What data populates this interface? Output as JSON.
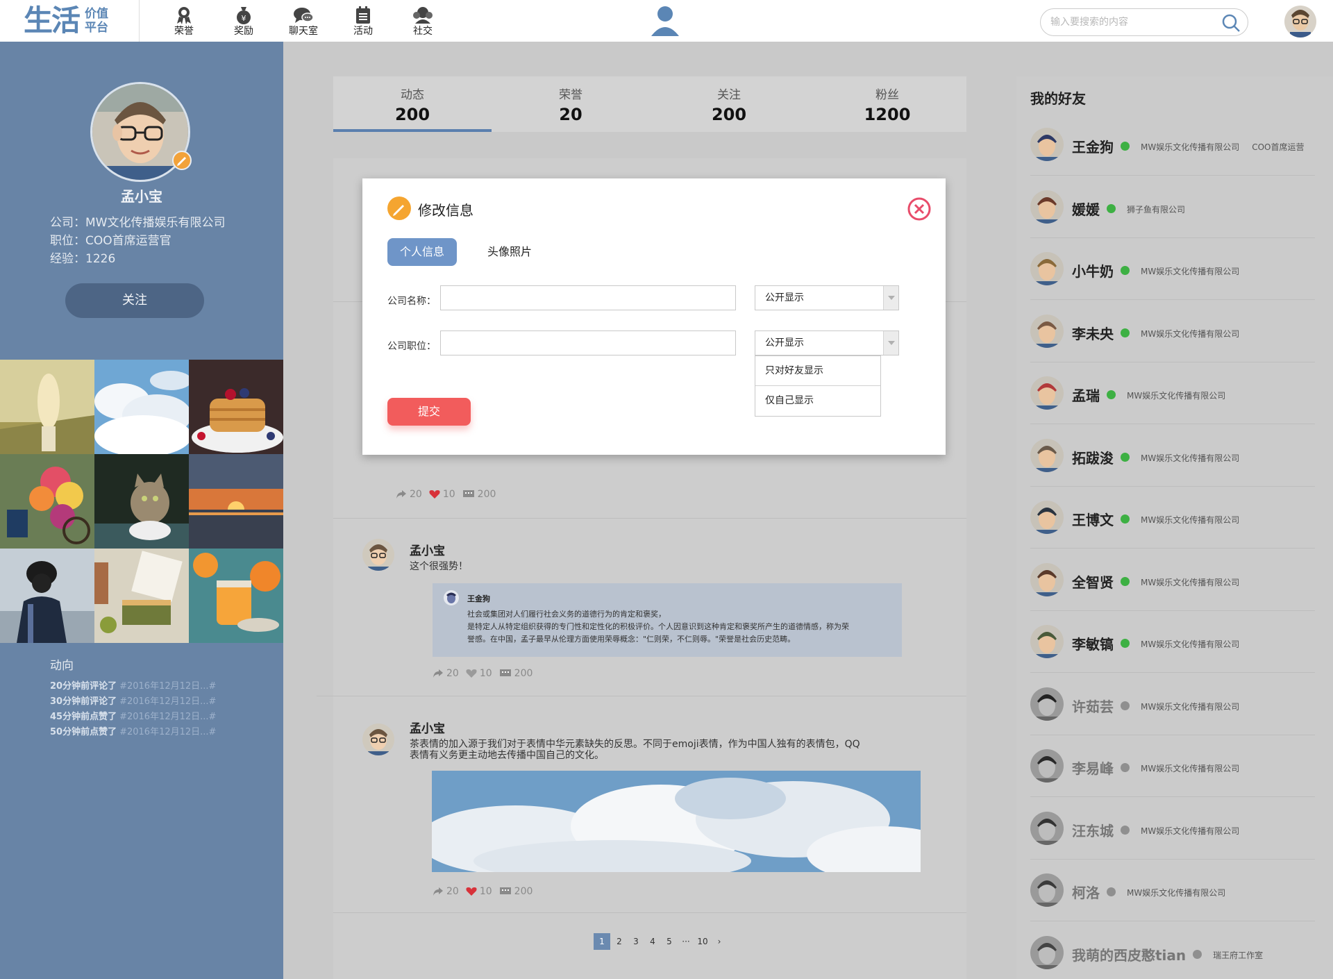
{
  "app": {
    "logo_main": "生活",
    "logo_sub_1": "价值",
    "logo_sub_2": "平台"
  },
  "nav": {
    "items": [
      {
        "label": "荣誉",
        "icon": "medal-icon"
      },
      {
        "label": "奖励",
        "icon": "money-bag-icon"
      },
      {
        "label": "聊天室",
        "icon": "chat-bubble-icon"
      },
      {
        "label": "活动",
        "icon": "calendar-icon"
      },
      {
        "label": "社交",
        "icon": "group-icon"
      }
    ]
  },
  "search": {
    "placeholder": "输入要搜索的内容",
    "icon": "search-icon"
  },
  "profile": {
    "name": "孟小宝",
    "company": "公司：MW文化传播娱乐有限公司",
    "position": "职位：COO首席运营官",
    "experience": "经验：1226",
    "follow_label": "关注"
  },
  "gallery": {
    "photos": [
      "field-girl",
      "clouds",
      "pancakes",
      "flower-cart",
      "cat",
      "sunset",
      "masked-person",
      "picnic",
      "orange-jam"
    ]
  },
  "trends": {
    "title": "动向",
    "items": [
      {
        "action": "20分钟前评论了",
        "link": "#2016年12月12日...#"
      },
      {
        "action": "30分钟前评论了",
        "link": "#2016年12月12日...#"
      },
      {
        "action": "45分钟前点赞了",
        "link": "#2016年12月12日...#"
      },
      {
        "action": "50分钟前点赞了",
        "link": "#2016年12月12日...#"
      }
    ]
  },
  "stats": [
    {
      "label": "动态",
      "value": "200"
    },
    {
      "label": "荣誉",
      "value": "20"
    },
    {
      "label": "关注",
      "value": "200"
    },
    {
      "label": "粉丝",
      "value": "1200"
    }
  ],
  "posts": {
    "first_actions": {
      "shares": "20",
      "likes": "10",
      "comments": "200"
    },
    "second": {
      "author": "孟小宝",
      "text": "这个很强势！",
      "quote_author": "王金狗",
      "quote_line_1": "社会或集团对人们履行社会义务的道德行为的肯定和褒奖，",
      "quote_line_2": "是特定人从特定组织获得的专门性和定性化的积极评价。个人因意识到这种肯定和褒奖所产生的道德情感，称为荣",
      "quote_line_3": "誉感。在中国，孟子最早从伦理方面使用荣辱概念：\"仁则荣，不仁则辱。\"荣誉是社会历史范畴。",
      "shares": "20",
      "likes": "10",
      "comments": "200"
    },
    "third": {
      "author": "孟小宝",
      "text_1": "茶表情的加入源于我们对于表情中华元素缺失的反思。不同于emoji表情，作为中国人独有的表情包，QQ",
      "text_2": "表情有义务更主动地去传播中国自己的文化。",
      "shares": "20",
      "likes": "10",
      "comments": "200"
    }
  },
  "pagination": {
    "pages": [
      "1",
      "2",
      "3",
      "4",
      "5"
    ],
    "ellipsis": "···",
    "last": "10",
    "next": "›"
  },
  "friends": {
    "title": "我的好友",
    "items": [
      {
        "name": "王金狗",
        "online": true,
        "company": "MW娱乐文化传播有限公司",
        "role": "COO首席运营"
      },
      {
        "name": "媛媛",
        "online": true,
        "company": "狮子鱼有限公司",
        "role": ""
      },
      {
        "name": "小牛奶",
        "online": true,
        "company": "MW娱乐文化传播有限公司",
        "role": ""
      },
      {
        "name": "李未央",
        "online": true,
        "company": "MW娱乐文化传播有限公司",
        "role": ""
      },
      {
        "name": "孟瑞",
        "online": true,
        "company": "MW娱乐文化传播有限公司",
        "role": ""
      },
      {
        "name": "拓跋浚",
        "online": true,
        "company": "MW娱乐文化传播有限公司",
        "role": ""
      },
      {
        "name": "王博文",
        "online": true,
        "company": "MW娱乐文化传播有限公司",
        "role": ""
      },
      {
        "name": "全智贤",
        "online": true,
        "company": "MW娱乐文化传播有限公司",
        "role": ""
      },
      {
        "name": "李敏镐",
        "online": true,
        "company": "MW娱乐文化传播有限公司",
        "role": ""
      },
      {
        "name": "许茹芸",
        "online": false,
        "company": "MW娱乐文化传播有限公司",
        "role": ""
      },
      {
        "name": "李易峰",
        "online": false,
        "company": "MW娱乐文化传播有限公司",
        "role": ""
      },
      {
        "name": "汪东城",
        "online": false,
        "company": "MW娱乐文化传播有限公司",
        "role": ""
      },
      {
        "name": "柯洛",
        "online": false,
        "company": "MW娱乐文化传播有限公司",
        "role": ""
      },
      {
        "name": "我萌的西皮憨tian",
        "online": false,
        "company": "瑞王府工作室",
        "role": ""
      }
    ],
    "online_color": "#3db043",
    "offline_color": "#8f8f8f"
  },
  "modal": {
    "title": "修改信息",
    "tab_active": "个人信息",
    "tab_other": "头像照片",
    "company_label": "公司名称：",
    "company_value": "",
    "position_label": "公司职位：",
    "position_value": "",
    "company_visibility": "公开显示",
    "position_visibility": "公开显示",
    "visibility_options": [
      "只对好友显示",
      "仅自己显示"
    ],
    "submit_label": "提交"
  },
  "colors": {
    "brand": "#5b86b5",
    "sidebar": "#6884a6",
    "submit": "#f25c5c",
    "tab_active": "#6f95c8",
    "close": "#e84c6a",
    "edit_icon": "#f5a530"
  }
}
